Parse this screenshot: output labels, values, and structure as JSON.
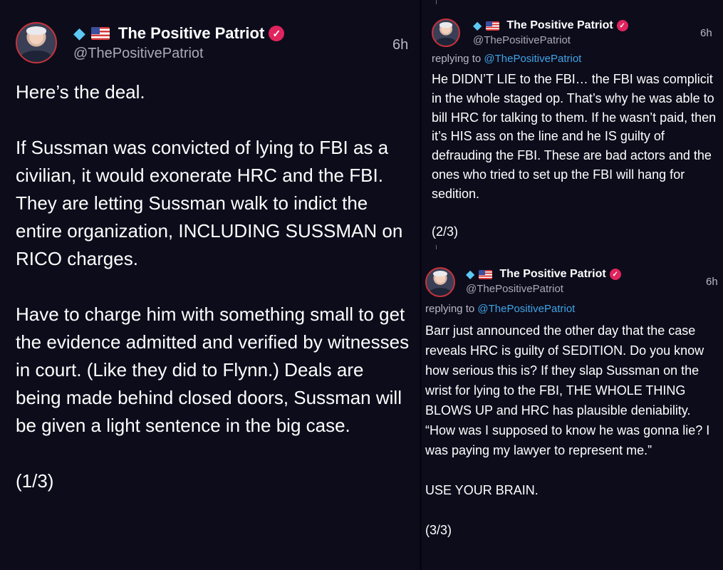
{
  "theme": {
    "background": "#0d0c1b",
    "name_color": "#ffffff",
    "handle_color": "#a9aab7",
    "mention_color": "#3fa5e8",
    "verified_color": "#e0245e"
  },
  "tweets": [
    {
      "display_name": "The Positive Patriot",
      "emoji_prefix": [
        "diamond-icon",
        "us-flag-icon"
      ],
      "handle": "@ThePositivePatriot",
      "time": "6h",
      "reply_prefix": "",
      "reply_mention": "",
      "body": "Here’s the deal.\n\nIf Sussman was convicted of lying to FBI as a civilian, it would exonerate HRC and the FBI.\nThey are letting Sussman walk to indict the entire organization, INCLUDING SUSSMAN on RICO charges.\n\nHave to charge him with something small to get the evidence admitted and verified by witnesses in court. (Like they did to Flynn.) Deals are being made behind closed doors, Sussman will be given a light sentence in the big case.\n\n(1/3)"
    },
    {
      "display_name": "The Positive Patriot",
      "emoji_prefix": [
        "diamond-icon",
        "us-flag-icon"
      ],
      "handle": "@ThePositivePatriot",
      "time": "6h",
      "reply_prefix": "replying to ",
      "reply_mention": "@ThePositivePatriot",
      "body": "He DIDN’T LIE to the FBI… the FBI was complicit in the whole staged op. That’s why he was able to bill HRC for talking to them. If he wasn’t paid, then it’s HIS ass on the line and he IS guilty of defrauding the FBI. These are bad actors and the ones who tried to set up the FBI will hang for sedition.\n\n(2/3)"
    },
    {
      "display_name": "The Positive Patriot",
      "emoji_prefix": [
        "diamond-icon",
        "us-flag-icon"
      ],
      "handle": "@ThePositivePatriot",
      "time": "6h",
      "reply_prefix": "replying to ",
      "reply_mention": "@ThePositivePatriot",
      "body": "Barr just announced the other day that the case reveals HRC is guilty of SEDITION. Do you know how serious this is? If they slap Sussman on the wrist for lying to the FBI, THE WHOLE THING BLOWS UP and HRC has plausible deniability. “How was I supposed to know he was gonna lie? I was paying my lawyer to represent me.”\n\nUSE YOUR BRAIN.\n\n(3/3)"
    }
  ]
}
